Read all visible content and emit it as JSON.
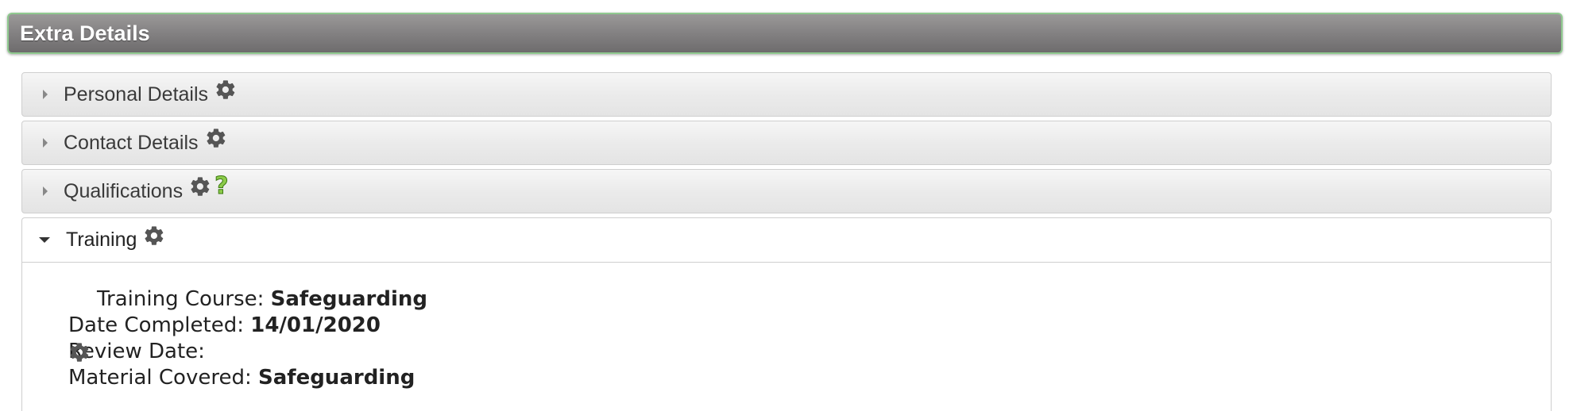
{
  "panel": {
    "title": "Extra Details"
  },
  "sections": {
    "personal": {
      "label": "Personal Details",
      "icon": "gear-icon"
    },
    "contact": {
      "label": "Contact Details",
      "icon": "gear-icon"
    },
    "qualifications": {
      "label": "Qualifications",
      "icon": "gear-icon",
      "help_icon": "question-icon"
    },
    "training": {
      "label": "Training",
      "icon": "gear-icon",
      "expanded": true
    }
  },
  "training_record": {
    "course_label": "Training Course: ",
    "course_value": "Safeguarding",
    "date_completed_label": "Date Completed: ",
    "date_completed_value": "14/01/2020",
    "review_date_label": "Review Date: ",
    "review_date_value": "",
    "material_label": "Material Covered: ",
    "material_value": "Safeguarding"
  },
  "colors": {
    "header_border": "#8fc98f",
    "header_bg": "#858384",
    "gear": "#555555",
    "help": "#8ccb4a"
  }
}
